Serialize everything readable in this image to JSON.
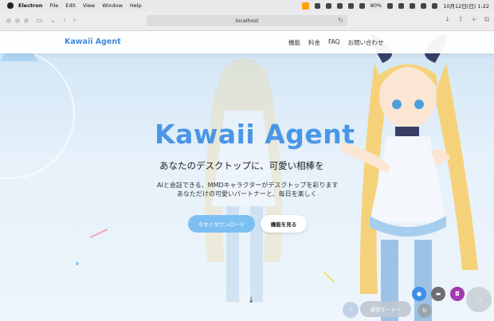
{
  "menubar": {
    "app": "Electron",
    "items": [
      "File",
      "Edit",
      "View",
      "Window",
      "Help"
    ],
    "battery": "80%",
    "datetime": "10月12日(日)  1:22"
  },
  "browser": {
    "url": "localhost"
  },
  "site": {
    "logo": "Kawaii Agent",
    "nav": [
      "機能",
      "料金",
      "FAQ",
      "お問い合わせ"
    ],
    "hero_title": "Kawaii Agent",
    "hero_subtitle": "あなたのデスクトップに、可愛い相棒を",
    "hero_desc_1": "AIと会話できる、MMDキャラクターがデスクトップを彩ります",
    "hero_desc_2": "あなただけの可愛いパートナーと、毎日を楽しく",
    "download_button": "今すぐダウンロード",
    "features_button": "機能を見る"
  },
  "overlay": {
    "normal_mode_button": "通常モードへ"
  },
  "colors": {
    "accent": "#4a96e6",
    "download_bg": "#7cc0f1",
    "mic": "#3b8fe8",
    "camera": "#a23ab0"
  }
}
